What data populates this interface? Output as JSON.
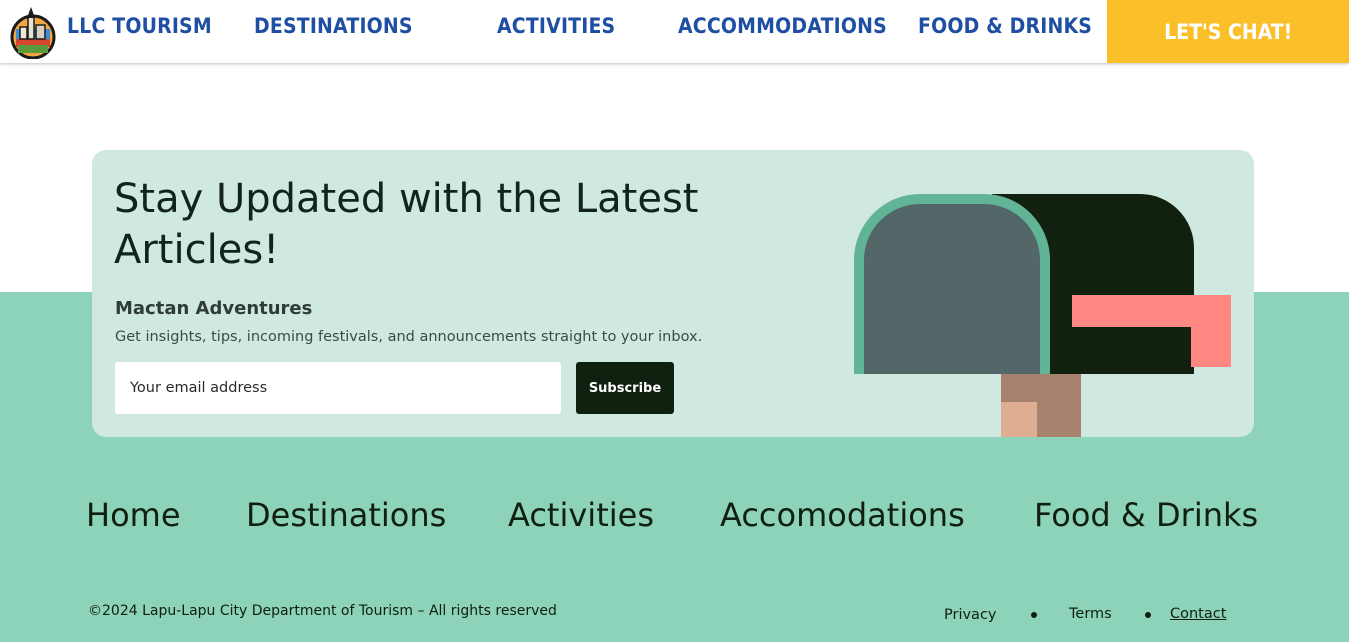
{
  "nav": {
    "brand": "LLC TOURISM",
    "links": [
      "DESTINATIONS",
      "ACTIVITIES",
      "ACCOMMODATIONS",
      "FOOD & DRINKS"
    ],
    "cta": "LET'S CHAT!"
  },
  "newsletter": {
    "title": "Stay Updated with the Latest Articles!",
    "subtitle": "Mactan Adventures",
    "description": "Get insights, tips, incoming festivals, and announcements straight to your inbox.",
    "email_placeholder": "Your email address",
    "button": "Subscribe"
  },
  "footer": {
    "links": [
      "Home",
      "Destinations",
      "Activities",
      "Accomodations",
      "Food & Drinks"
    ],
    "copyright": "©2024 Lapu-Lapu City Department of Tourism  – All rights reserved",
    "legal": [
      "Privacy",
      "Terms",
      "Contact"
    ]
  },
  "colors": {
    "accent": "#fbbf2a",
    "nav_text": "#1f4fa3",
    "footer_bg": "#8dd3b9",
    "card_bg": "#cfe9e1",
    "dark": "#10200f"
  },
  "icons": [
    "llc-tourism-logo",
    "mailbox-illustration"
  ]
}
